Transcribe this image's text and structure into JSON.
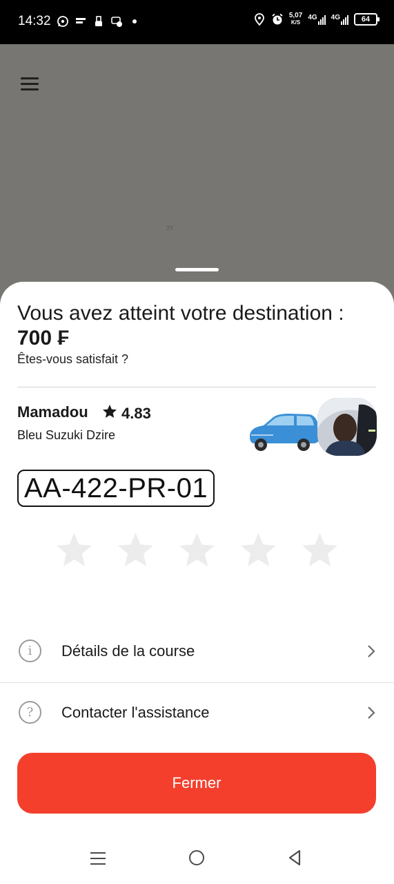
{
  "status_bar": {
    "time": "14:32",
    "speed_value": "5,07",
    "speed_unit": "K/S",
    "network_1": "4G",
    "network_2": "4G",
    "battery": "64",
    "left_icons": [
      "whatsapp-icon",
      "data-saver-icon",
      "usb-icon",
      "chat-icon"
    ],
    "right_icons": [
      "location-icon",
      "alarm-icon"
    ]
  },
  "map": {
    "marker_text": "77"
  },
  "trip": {
    "title": "Vous avez atteint votre destination :",
    "price": "700 ₣",
    "subtitle": "Êtes-vous satisfait ?"
  },
  "driver": {
    "name": "Mamadou",
    "rating": "4.83",
    "vehicle": "Bleu Suzuki Dzire",
    "plate": "AA-422-PR-01",
    "car_color": "#3a8fd6"
  },
  "rating_stars": {
    "count": 5,
    "selected": 0
  },
  "menu": {
    "details_label": "Détails de la course",
    "support_label": "Contacter l'assistance"
  },
  "actions": {
    "close_label": "Fermer",
    "accent_color": "#f43f2d"
  }
}
